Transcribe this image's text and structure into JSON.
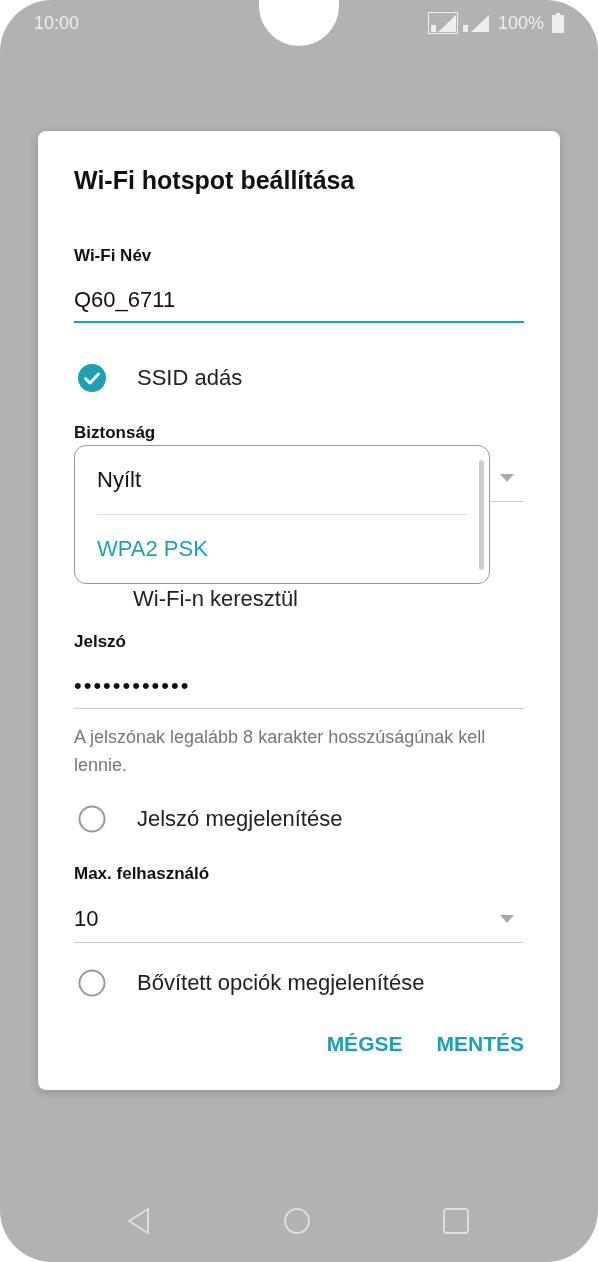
{
  "status_bar": {
    "time": "10:00",
    "battery": "100%"
  },
  "dialog": {
    "title": "Wi-Fi hotspot beállítása",
    "fields": [
      {
        "kind": "text",
        "label": "Wi-Fi Név",
        "value": "Q60_6711",
        "focused": true
      },
      {
        "kind": "checkbox",
        "label": "SSID adás",
        "checked": true
      },
      {
        "kind": "select",
        "label": "Biztonság",
        "dropdown": true
      },
      {
        "kind": "covered",
        "label": "Wi-Fi-n keresztül"
      },
      {
        "kind": "password",
        "label": "Jelszó",
        "value": "••••••••••••"
      },
      {
        "kind": "hint",
        "text": "A jelszónak legalább 8 karakter hosszúságúnak kell lennie."
      },
      {
        "kind": "radio",
        "label": "Jelszó megjelenítése",
        "checked": false
      },
      {
        "kind": "select",
        "label": "Max. felhasználó",
        "value": "10"
      },
      {
        "kind": "radio",
        "label": "Bővített opciók megjelenítése",
        "checked": false
      }
    ],
    "dropdown_options": [
      {
        "label": "Nyílt",
        "selected": false
      },
      {
        "label": "WPA2 PSK",
        "selected": true
      }
    ],
    "buttons": [
      "MÉGSE",
      "MENTÉS"
    ]
  }
}
